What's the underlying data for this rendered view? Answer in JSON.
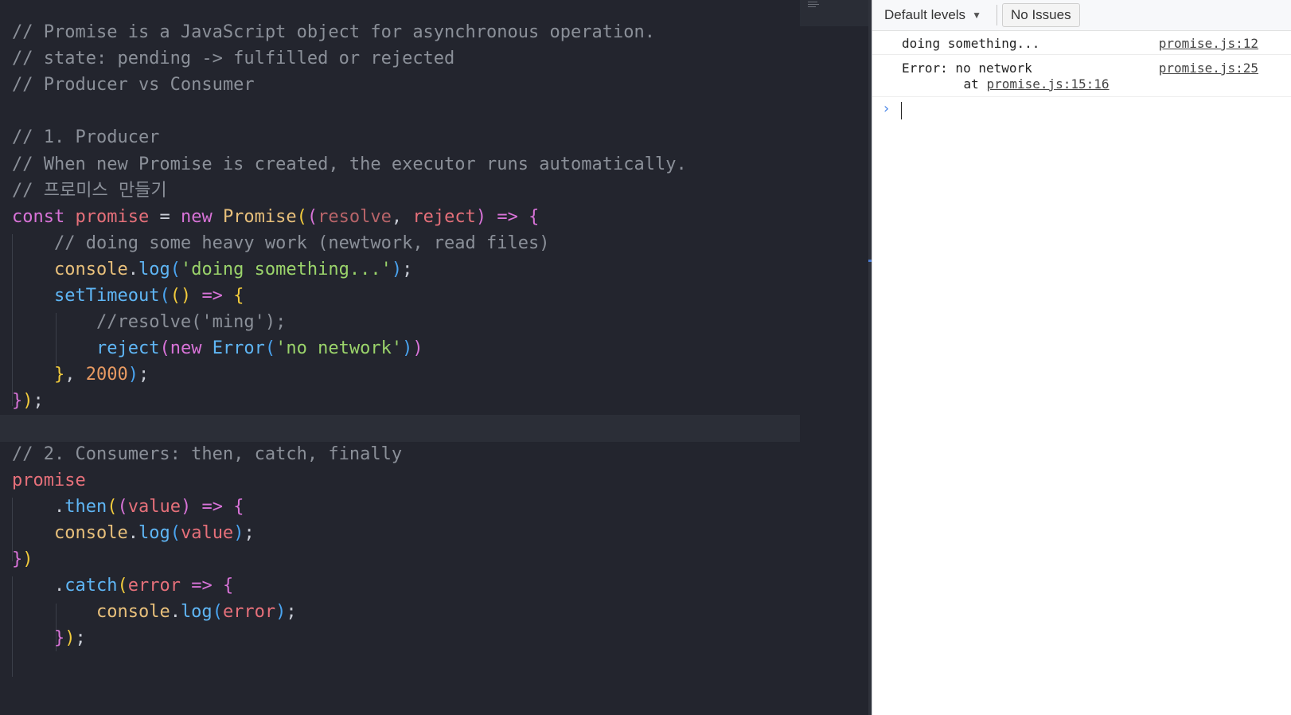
{
  "editor": {
    "lines": [
      [
        {
          "c": "t-comment",
          "t": "// Promise is a JavaScript object for asynchronous operation."
        }
      ],
      [
        {
          "c": "t-comment",
          "t": "// state: pending -> fulfilled or rejected"
        }
      ],
      [
        {
          "c": "t-comment",
          "t": "// Producer vs Consumer"
        }
      ],
      [],
      [
        {
          "c": "t-comment",
          "t": "// 1. Producer"
        }
      ],
      [
        {
          "c": "t-comment",
          "t": "// When new Promise is created, the executor runs automatically."
        }
      ],
      [
        {
          "c": "t-comment",
          "t": "// 프로미스 만들기"
        }
      ],
      [
        {
          "c": "t-kw",
          "t": "const "
        },
        {
          "c": "t-var",
          "t": "promise"
        },
        {
          "c": "t-plain",
          "t": " = "
        },
        {
          "c": "t-kw",
          "t": "new "
        },
        {
          "c": "t-class",
          "t": "Promise"
        },
        {
          "c": "t-yellow",
          "t": "("
        },
        {
          "c": "t-pink",
          "t": "("
        },
        {
          "c": "t-param-dim",
          "t": "resolve"
        },
        {
          "c": "t-plain",
          "t": ", "
        },
        {
          "c": "t-param",
          "t": "reject"
        },
        {
          "c": "t-pink",
          "t": ")"
        },
        {
          "c": "t-plain",
          "t": " "
        },
        {
          "c": "t-kw",
          "t": "=>"
        },
        {
          "c": "t-plain",
          "t": " "
        },
        {
          "c": "t-pink",
          "t": "{"
        }
      ],
      [
        {
          "c": "t-plain",
          "t": "    "
        },
        {
          "c": "t-comment",
          "t": "// doing some heavy work (newtwork, read files)"
        }
      ],
      [
        {
          "c": "t-plain",
          "t": "    "
        },
        {
          "c": "t-class",
          "t": "console"
        },
        {
          "c": "t-plain",
          "t": "."
        },
        {
          "c": "t-fn",
          "t": "log"
        },
        {
          "c": "t-blue",
          "t": "("
        },
        {
          "c": "t-str",
          "t": "'doing something...'"
        },
        {
          "c": "t-blue",
          "t": ")"
        },
        {
          "c": "t-plain",
          "t": ";"
        }
      ],
      [
        {
          "c": "t-plain",
          "t": "    "
        },
        {
          "c": "t-fn",
          "t": "setTimeout"
        },
        {
          "c": "t-blue",
          "t": "("
        },
        {
          "c": "t-yellow",
          "t": "()"
        },
        {
          "c": "t-plain",
          "t": " "
        },
        {
          "c": "t-kw",
          "t": "=>"
        },
        {
          "c": "t-plain",
          "t": " "
        },
        {
          "c": "t-yellow",
          "t": "{"
        }
      ],
      [
        {
          "c": "t-plain",
          "t": "        "
        },
        {
          "c": "t-comment",
          "t": "//resolve('ming');"
        }
      ],
      [
        {
          "c": "t-plain",
          "t": "        "
        },
        {
          "c": "t-fn",
          "t": "reject"
        },
        {
          "c": "t-pink",
          "t": "("
        },
        {
          "c": "t-kw",
          "t": "new "
        },
        {
          "c": "t-fn",
          "t": "Error"
        },
        {
          "c": "t-blue",
          "t": "("
        },
        {
          "c": "t-str",
          "t": "'no network'"
        },
        {
          "c": "t-blue",
          "t": ")"
        },
        {
          "c": "t-pink",
          "t": ")"
        }
      ],
      [
        {
          "c": "t-plain",
          "t": "    "
        },
        {
          "c": "t-yellow",
          "t": "}"
        },
        {
          "c": "t-plain",
          "t": ", "
        },
        {
          "c": "t-num",
          "t": "2000"
        },
        {
          "c": "t-blue",
          "t": ")"
        },
        {
          "c": "t-plain",
          "t": ";"
        }
      ],
      [
        {
          "c": "t-pink",
          "t": "}"
        },
        {
          "c": "t-yellow",
          "t": ")"
        },
        {
          "c": "t-plain",
          "t": ";"
        }
      ],
      [],
      [
        {
          "c": "t-comment",
          "t": "// 2. Consumers: then, catch, finally"
        }
      ],
      [
        {
          "c": "t-var",
          "t": "promise"
        }
      ],
      [
        {
          "c": "t-plain",
          "t": "    ."
        },
        {
          "c": "t-fn",
          "t": "then"
        },
        {
          "c": "t-yellow",
          "t": "("
        },
        {
          "c": "t-pink",
          "t": "("
        },
        {
          "c": "t-param",
          "t": "value"
        },
        {
          "c": "t-pink",
          "t": ")"
        },
        {
          "c": "t-plain",
          "t": " "
        },
        {
          "c": "t-kw",
          "t": "=>"
        },
        {
          "c": "t-plain",
          "t": " "
        },
        {
          "c": "t-pink",
          "t": "{"
        }
      ],
      [
        {
          "c": "t-plain",
          "t": "    "
        },
        {
          "c": "t-class",
          "t": "console"
        },
        {
          "c": "t-plain",
          "t": "."
        },
        {
          "c": "t-fn",
          "t": "log"
        },
        {
          "c": "t-blue",
          "t": "("
        },
        {
          "c": "t-param",
          "t": "value"
        },
        {
          "c": "t-blue",
          "t": ")"
        },
        {
          "c": "t-plain",
          "t": ";"
        }
      ],
      [
        {
          "c": "t-pink",
          "t": "}"
        },
        {
          "c": "t-yellow",
          "t": ")"
        }
      ],
      [
        {
          "c": "t-plain",
          "t": "    ."
        },
        {
          "c": "t-fn",
          "t": "catch"
        },
        {
          "c": "t-yellow",
          "t": "("
        },
        {
          "c": "t-param",
          "t": "error"
        },
        {
          "c": "t-plain",
          "t": " "
        },
        {
          "c": "t-kw",
          "t": "=>"
        },
        {
          "c": "t-plain",
          "t": " "
        },
        {
          "c": "t-pink",
          "t": "{"
        }
      ],
      [
        {
          "c": "t-plain",
          "t": "        "
        },
        {
          "c": "t-class",
          "t": "console"
        },
        {
          "c": "t-plain",
          "t": "."
        },
        {
          "c": "t-fn",
          "t": "log"
        },
        {
          "c": "t-blue",
          "t": "("
        },
        {
          "c": "t-param",
          "t": "error"
        },
        {
          "c": "t-blue",
          "t": ")"
        },
        {
          "c": "t-plain",
          "t": ";"
        }
      ],
      [
        {
          "c": "t-plain",
          "t": "    "
        },
        {
          "c": "t-pink",
          "t": "}"
        },
        {
          "c": "t-yellow",
          "t": ")"
        },
        {
          "c": "t-plain",
          "t": ";"
        }
      ]
    ],
    "current_line": 15
  },
  "console": {
    "toolbar": {
      "levels_label": "Default levels",
      "issues_label": "No Issues"
    },
    "messages": [
      {
        "text": "doing something...",
        "source": "promise.js:12"
      },
      {
        "text": "Error: no network",
        "source": "promise.js:25",
        "stack_prefix": "    at ",
        "stack_link": "promise.js:15:16"
      }
    ]
  }
}
